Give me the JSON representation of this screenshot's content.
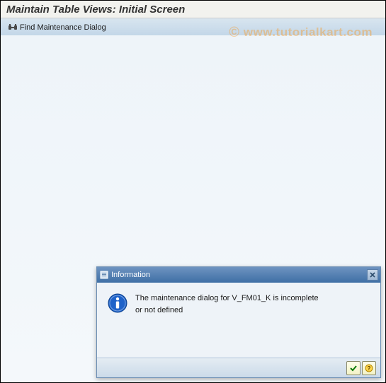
{
  "header": {
    "title": "Maintain Table Views: Initial Screen"
  },
  "toolbar": {
    "find_label": "Find Maintenance Dialog"
  },
  "watermark": {
    "symbol": "©",
    "text": " www.tutorialkart.com"
  },
  "dialog": {
    "title": "Information",
    "message_line1": "The maintenance dialog for V_FM01_K is incomplete",
    "message_line2": "or not defined"
  }
}
